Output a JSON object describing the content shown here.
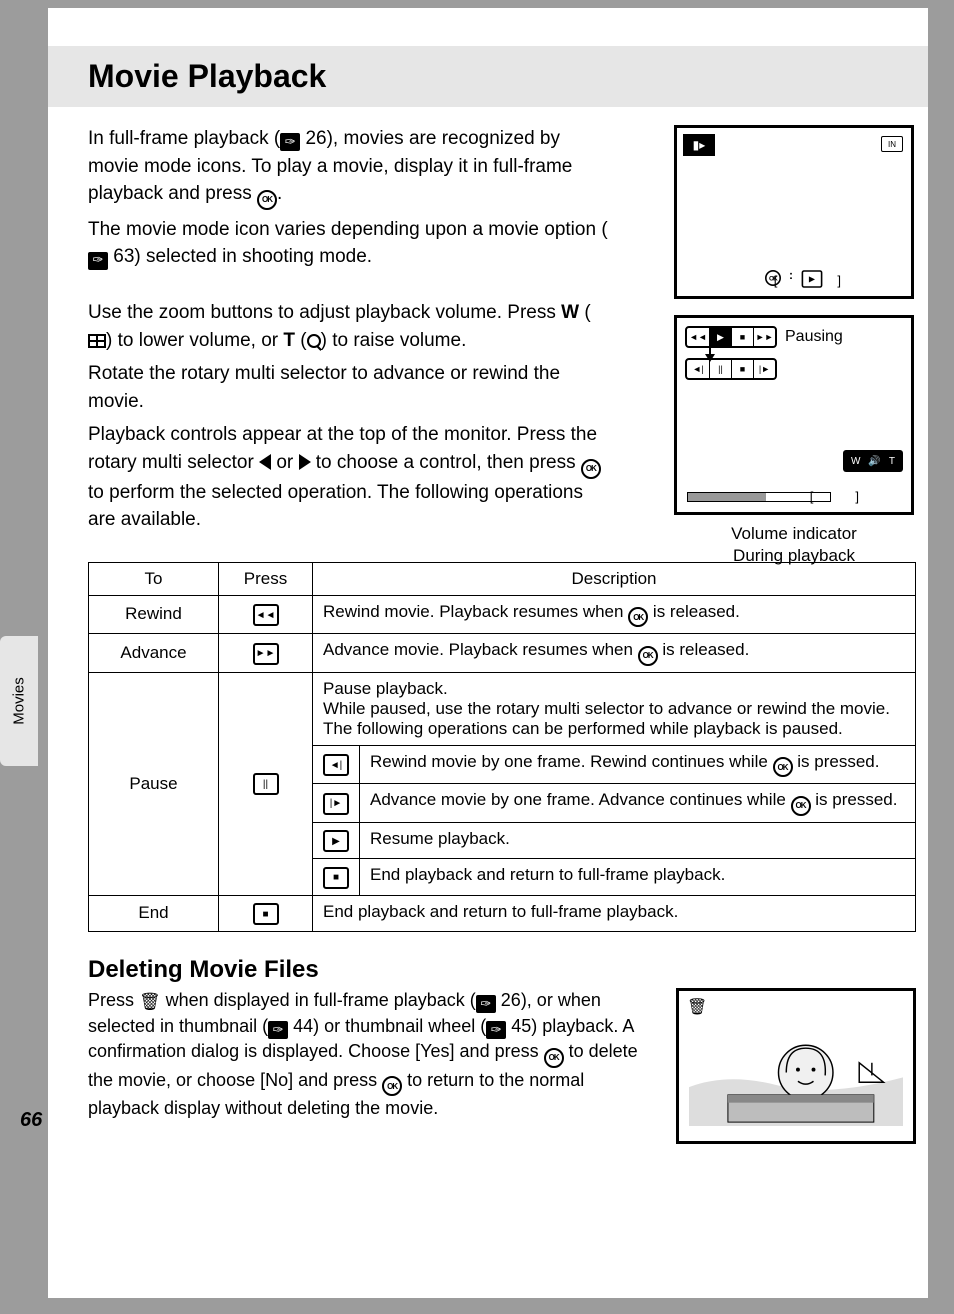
{
  "sideTab": "Movies",
  "pageNumber": "66",
  "heading1": "Movie Playback",
  "intro": {
    "p1a": "In full-frame playback (",
    "p1_ref1": "26",
    "p1b": "), movies are recognized by movie mode icons. To play a movie, display it in full-frame playback and press ",
    "p1c": ".",
    "p2a": "The movie mode icon varies depending upon a movie option (",
    "p2_ref1": "63",
    "p2b": ") selected in shooting mode.",
    "p3a": "Use the zoom buttons to adjust playback volume. Press ",
    "p3_w": "W",
    "p3b": " (",
    "p3c": ") to lower volume, or ",
    "p3_t": "T",
    "p3d": " (",
    "p3e": ") to raise volume.",
    "p4": "Rotate the rotary multi selector to advance or rewind the movie.",
    "p5a": "Playback controls appear at the top of the monitor. Press the rotary multi selector ",
    "p5b": " or ",
    "p5c": "  to choose a control, then press ",
    "p5d": " to perform the selected operation. The following operations are available."
  },
  "fig": {
    "pausing": "Pausing",
    "caption1": "Volume indicator",
    "caption2": "During playback",
    "in": "IN"
  },
  "table": {
    "headers": {
      "to": "To",
      "press": "Press",
      "desc": "Description"
    },
    "rows": {
      "rewind": {
        "to": "Rewind",
        "desc_a": "Rewind movie. Playback resumes when ",
        "desc_b": " is released."
      },
      "advance": {
        "to": "Advance",
        "desc_a": "Advance movie. Playback resumes when ",
        "desc_b": " is released."
      },
      "pause": {
        "to": "Pause",
        "desc_head": "Pause playback.\nWhile paused, use the rotary multi selector to advance or rewind the movie. The following operations can be performed while playback is paused.",
        "sub": {
          "r1a": "Rewind movie by one frame. Rewind continues while ",
          "r1b": " is pressed.",
          "r2a": "Advance movie by one frame. Advance continues while ",
          "r2b": " is pressed.",
          "r3": "Resume playback.",
          "r4": "End playback and return to full-frame playback."
        }
      },
      "end": {
        "to": "End",
        "desc": "End playback and return to full-frame playback."
      }
    }
  },
  "heading2": "Deleting Movie Files",
  "delete": {
    "a": "Press ",
    "b": " when displayed in full-frame playback (",
    "ref1": "26",
    "c": "), or when selected in thumbnail (",
    "ref2": "44",
    "d": ") or thumbnail wheel (",
    "ref3": "45",
    "e": ") playback. A confirmation dialog is displayed. Choose [Yes] and press ",
    "f": " to delete the movie, or choose [No] and press ",
    "g": " to return to the normal playback display without deleting the movie."
  }
}
